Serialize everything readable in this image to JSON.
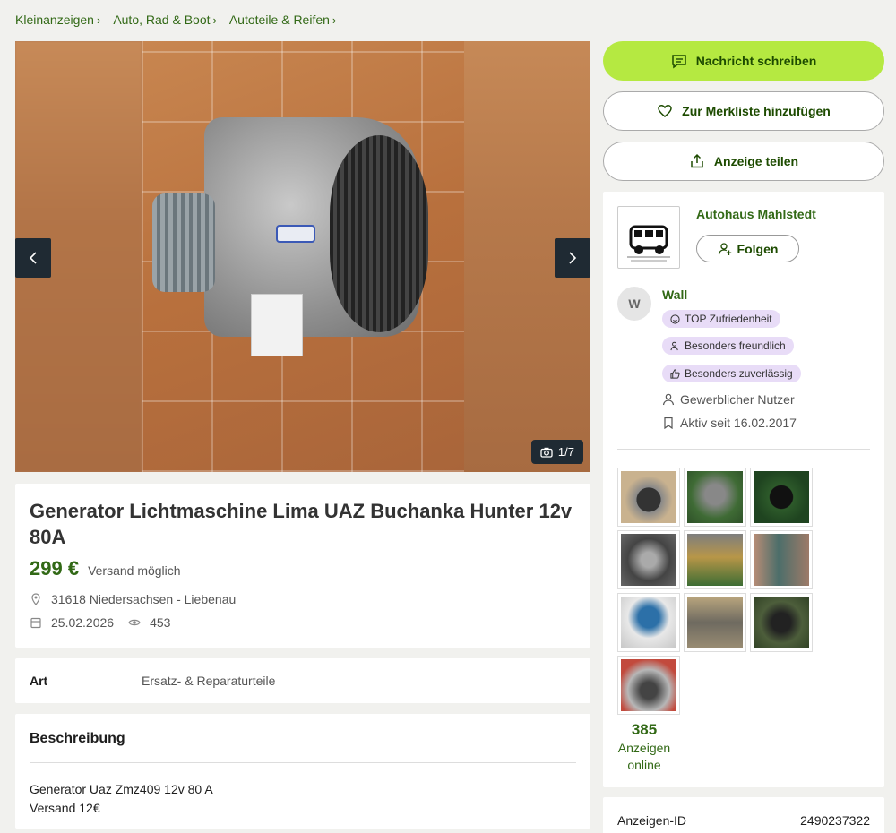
{
  "breadcrumb": [
    "Kleinanzeigen",
    "Auto, Rad & Boot",
    "Autoteile & Reifen"
  ],
  "gallery": {
    "counter": "1/7"
  },
  "listing": {
    "title": "Generator Lichtmaschine Lima UAZ Buchanka Hunter 12v 80A",
    "price": "299 €",
    "shipping": "Versand möglich",
    "location": "31618 Niedersachsen - Liebenau",
    "date": "25.02.2026",
    "views": "453"
  },
  "attributes": [
    {
      "key": "Art",
      "value": "Ersatz- & Reparaturteile"
    }
  ],
  "description": {
    "heading": "Beschreibung",
    "lines": [
      "Generator Uaz Zmz409 12v 80 A",
      "Versand 12€"
    ]
  },
  "actions": {
    "message": "Nachricht schreiben",
    "save": "Zur Merkliste hinzufügen",
    "share": "Anzeige teilen"
  },
  "seller": {
    "store_name": "Autohaus Mahlstedt",
    "follow": "Folgen",
    "avatar_initial": "W",
    "user_name": "Wall",
    "badges": [
      "TOP Zufriedenheit",
      "Besonders freundlich",
      "Besonders zuverlässig"
    ],
    "user_type": "Gewerblicher Nutzer",
    "active_since": "Aktiv seit 16.02.2017",
    "ads_count": "385",
    "ads_label": "Anzeigen online"
  },
  "ad_id": {
    "label": "Anzeigen-ID",
    "value": "2490237322"
  },
  "colors": {
    "accent": "#326916",
    "primary_button": "#b5e941",
    "badge": "#e8dcf7"
  }
}
